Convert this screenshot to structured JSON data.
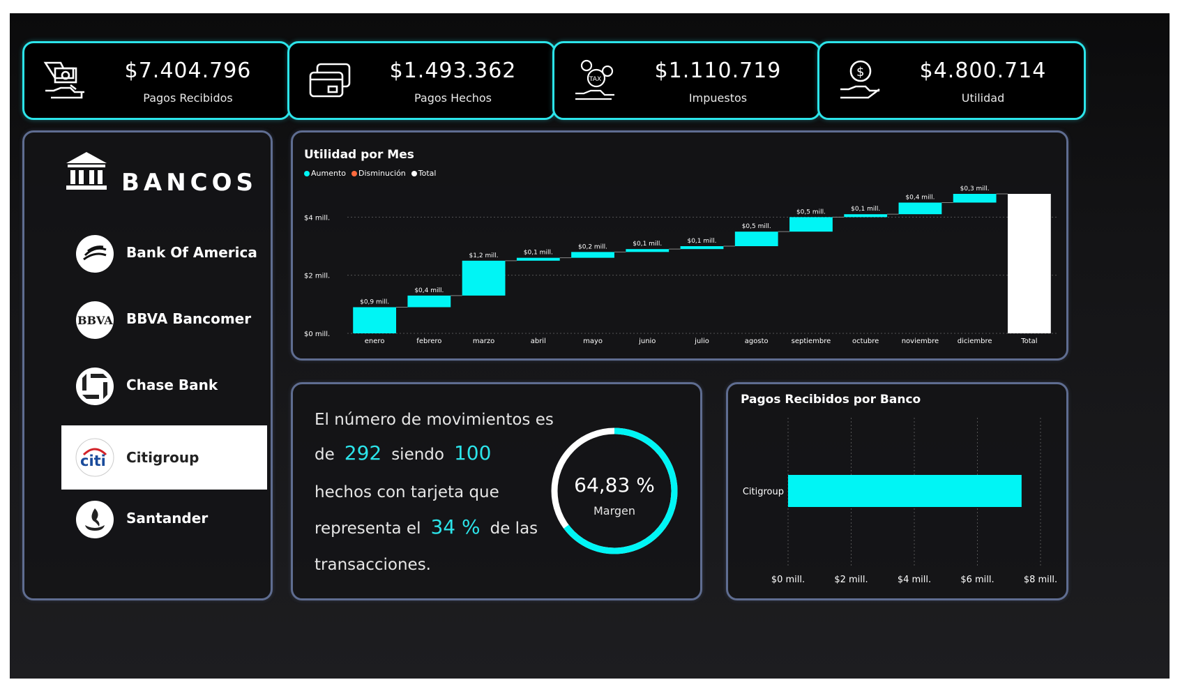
{
  "colors": {
    "accent": "#2ce4ea",
    "increase": "#00f5f5",
    "decrease": "#ff6a3d",
    "total": "#ffffff",
    "border": "#5f6d91"
  },
  "kpis": [
    {
      "icon": "money-exchange-icon",
      "value": "$7.404.796",
      "label": "Pagos Recibidos"
    },
    {
      "icon": "credit-card-icon",
      "value": "$1.493.362",
      "label": "Pagos Hechos"
    },
    {
      "icon": "tax-hand-icon",
      "value": "$1.110.719",
      "label": "Impuestos"
    },
    {
      "icon": "dollar-hand-icon",
      "value": "$4.800.714",
      "label": "Utilidad"
    }
  ],
  "banks": {
    "title": "BANCOS",
    "items": [
      {
        "name": "Bank Of America",
        "icon": "bank-of-america-logo",
        "selected": false
      },
      {
        "name": "BBVA Bancomer",
        "icon": "bbva-logo",
        "logo_text": "BBVA",
        "selected": false
      },
      {
        "name": "Chase Bank",
        "icon": "chase-logo",
        "selected": false
      },
      {
        "name": "Citigroup",
        "icon": "citi-logo",
        "logo_text": "citi",
        "selected": true
      },
      {
        "name": "Santander",
        "icon": "santander-logo",
        "selected": false
      }
    ]
  },
  "waterfall": {
    "title": "Utilidad por Mes",
    "legend": [
      "Aumento",
      "Disminución",
      "Total"
    ]
  },
  "summary": {
    "line1": "El número de movimientos es",
    "de": "de",
    "movements": "292",
    "siendo": "siendo",
    "card_count": "100",
    "line3": "hechos con tarjeta que",
    "represents": "representa el",
    "percent": "34 %",
    "de_las": "de las",
    "line5": "transacciones."
  },
  "gauge": {
    "value_text": "64,83 %",
    "label": "Margen",
    "fraction": 0.6483
  },
  "bank_payments": {
    "title": "Pagos Recibidos por Banco"
  },
  "chart_data": [
    {
      "type": "bar",
      "subtype": "waterfall",
      "title": "Utilidad por Mes",
      "categories": [
        "enero",
        "febrero",
        "marzo",
        "abril",
        "mayo",
        "junio",
        "julio",
        "agosto",
        "septiembre",
        "octubre",
        "noviembre",
        "diciembre",
        "Total"
      ],
      "values": [
        0.9,
        0.4,
        1.2,
        0.1,
        0.2,
        0.1,
        0.1,
        0.5,
        0.5,
        0.1,
        0.4,
        0.3,
        4.8
      ],
      "data_labels": [
        "$0,9 mill.",
        "$0,4 mill.",
        "$1,2 mill.",
        "$0,1 mill.",
        "$0,2 mill.",
        "$0,1 mill.",
        "$0,1 mill.",
        "$0,5 mill.",
        "$0,5 mill.",
        "$0,1 mill.",
        "$0,4 mill.",
        "$0,3 mill.",
        ""
      ],
      "series": [
        {
          "name": "Aumento"
        },
        {
          "name": "Disminución"
        },
        {
          "name": "Total"
        }
      ],
      "ylim": [
        0,
        4.8
      ],
      "yticks": [
        0,
        2,
        4
      ],
      "ytick_labels": [
        "$0 mill.",
        "$2 mill.",
        "$4 mill."
      ],
      "grid": true,
      "legend": "top-left"
    },
    {
      "type": "bar",
      "orientation": "horizontal",
      "title": "Pagos Recibidos por Banco",
      "categories": [
        "Citigroup"
      ],
      "values": [
        7.4
      ],
      "xlim": [
        0,
        8
      ],
      "xticks": [
        0,
        2,
        4,
        6,
        8
      ],
      "xtick_labels": [
        "$0 mill.",
        "$2 mill.",
        "$4 mill.",
        "$6 mill.",
        "$8 mill."
      ],
      "grid": true
    }
  ]
}
